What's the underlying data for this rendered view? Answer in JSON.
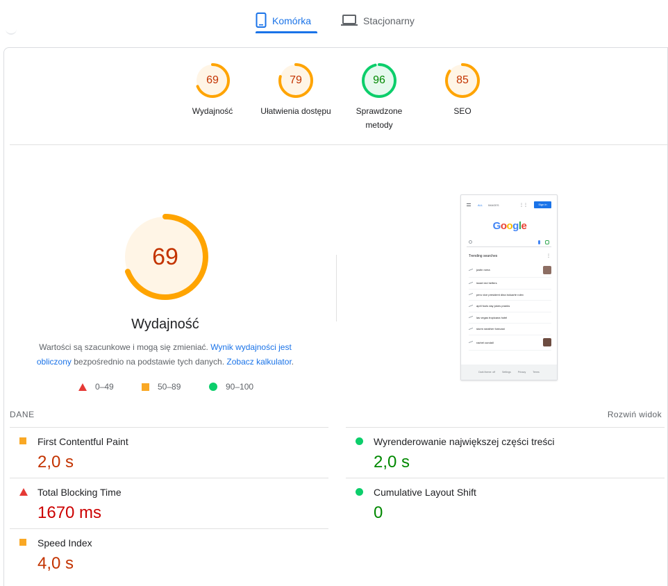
{
  "tabs": [
    {
      "label": "Komórka",
      "icon": "smartphone-icon",
      "active": true
    },
    {
      "label": "Stacjonarny",
      "icon": "laptop-icon",
      "active": false
    }
  ],
  "scores": [
    {
      "value": "69",
      "label": "Wydajność",
      "color": "#ffa400"
    },
    {
      "value": "79",
      "label": "Ułatwienia dostępu",
      "color": "#ffa400"
    },
    {
      "value": "96",
      "label_line1": "Sprawdzone",
      "label_line2": "metody",
      "color": "#0cce6b"
    },
    {
      "value": "85",
      "label": "SEO",
      "color": "#ffa400"
    }
  ],
  "performance": {
    "score": "69",
    "title": "Wydajność",
    "desc_part1": "Wartości są szacunkowe i mogą się zmieniać. ",
    "desc_link1": "Wynik wydajności jest obliczony",
    "desc_part2": " bezpośrednio na podstawie tych danych. ",
    "desc_link2": "Zobacz kalkulator",
    "desc_part3": "."
  },
  "legend": [
    {
      "range": "0–49",
      "shape": "triangle",
      "color": "#e53935"
    },
    {
      "range": "50–89",
      "shape": "square",
      "color": "#f9a825"
    },
    {
      "range": "90–100",
      "shape": "circle",
      "color": "#0cce6b"
    }
  ],
  "screenshot": {
    "nav_all": "ALL",
    "nav_images": "IMAGES",
    "signin": "Sign in",
    "trending_title": "Trending searches",
    "items": [
      "justin roma",
      "israel red heifers",
      "peru vice president dina boluarte rolex",
      "april fools day jokes pranks",
      "las vegas tropicana hotel",
      "storm weather forecast",
      "rachel cundall"
    ],
    "footer": [
      "Dark theme: off",
      "Settings",
      "Privacy",
      "Terms"
    ]
  },
  "metrics_header": {
    "left": "DANE",
    "right": "Rozwiń widok"
  },
  "metrics": [
    {
      "name": "First Contentful Paint",
      "value": "2,0 s",
      "status": "average"
    },
    {
      "name": "Wyrenderowanie największej części treści",
      "value": "2,0 s",
      "status": "pass"
    },
    {
      "name": "Total Blocking Time",
      "value": "1670 ms",
      "status": "fail"
    },
    {
      "name": "Cumulative Layout Shift",
      "value": "0",
      "status": "pass"
    },
    {
      "name": "Speed Index",
      "value": "4,0 s",
      "status": "average"
    }
  ]
}
